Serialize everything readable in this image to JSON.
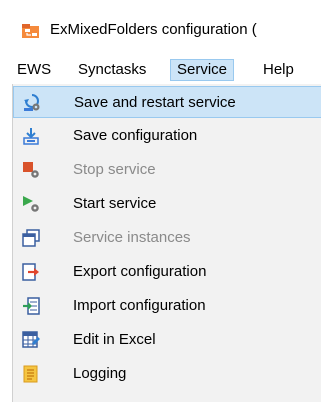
{
  "window": {
    "title": "ExMixedFolders configuration ("
  },
  "menubar": {
    "items": [
      {
        "label": "EWS"
      },
      {
        "label": "Synctasks"
      },
      {
        "label": "Service",
        "active": true
      },
      {
        "label": "Help"
      }
    ]
  },
  "dropdown": {
    "items": [
      {
        "label": "Save and restart service",
        "icon": "save-restart-icon",
        "enabled": true,
        "highlighted": true
      },
      {
        "label": "Save configuration",
        "icon": "save-icon",
        "enabled": true
      },
      {
        "label": "Stop service",
        "icon": "stop-service-icon",
        "enabled": false
      },
      {
        "label": "Start service",
        "icon": "start-service-icon",
        "enabled": true
      },
      {
        "label": "Service instances",
        "icon": "service-instances-icon",
        "enabled": false
      },
      {
        "label": "Export configuration",
        "icon": "export-icon",
        "enabled": true
      },
      {
        "label": "Import configuration",
        "icon": "import-icon",
        "enabled": true
      },
      {
        "label": "Edit in Excel",
        "icon": "excel-icon",
        "enabled": true
      },
      {
        "label": "Logging",
        "icon": "logging-icon",
        "enabled": true
      }
    ]
  },
  "colors": {
    "highlight": "#cce4f7",
    "highlight_border": "#99c9ef",
    "disabled_text": "#8a8a8a",
    "menu_background": "#f2f2f2"
  }
}
